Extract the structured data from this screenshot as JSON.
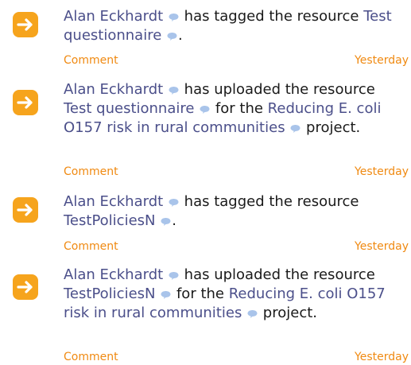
{
  "activity_feed": {
    "items": [
      {
        "actor": "Alan Eckhardt",
        "verb": "has tagged the resource",
        "resource": "Test questionnaire",
        "suffix": ".",
        "comment_label": "Comment",
        "time": "Yesterday"
      },
      {
        "actor": "Alan Eckhardt",
        "verb": "has uploaded the resource",
        "resource": "Test questionnaire",
        "connector": "for the",
        "project": "Reducing E. coli O157 risk in rural communities",
        "suffix": "project.",
        "comment_label": "Comment",
        "time": "Yesterday"
      },
      {
        "actor": "Alan Eckhardt",
        "verb": "has tagged the resource",
        "resource": "TestPoliciesN",
        "suffix": ".",
        "comment_label": "Comment",
        "time": "Yesterday"
      },
      {
        "actor": "Alan Eckhardt",
        "verb": "has uploaded the resource",
        "resource": "TestPoliciesN",
        "connector": "for the",
        "project": "Reducing E. coli O157 risk in rural communities",
        "suffix": "project.",
        "comment_label": "Comment",
        "time": "Yesterday"
      }
    ]
  },
  "icons": {
    "activity_icon": "arrow-right-icon",
    "info_icon": "speech-bubble-icon"
  },
  "colors": {
    "accent_orange": "#f6a41d",
    "meta_orange": "#f08a12",
    "link_blue": "#4b4f8a",
    "bubble_blue": "#a9c4ea"
  }
}
